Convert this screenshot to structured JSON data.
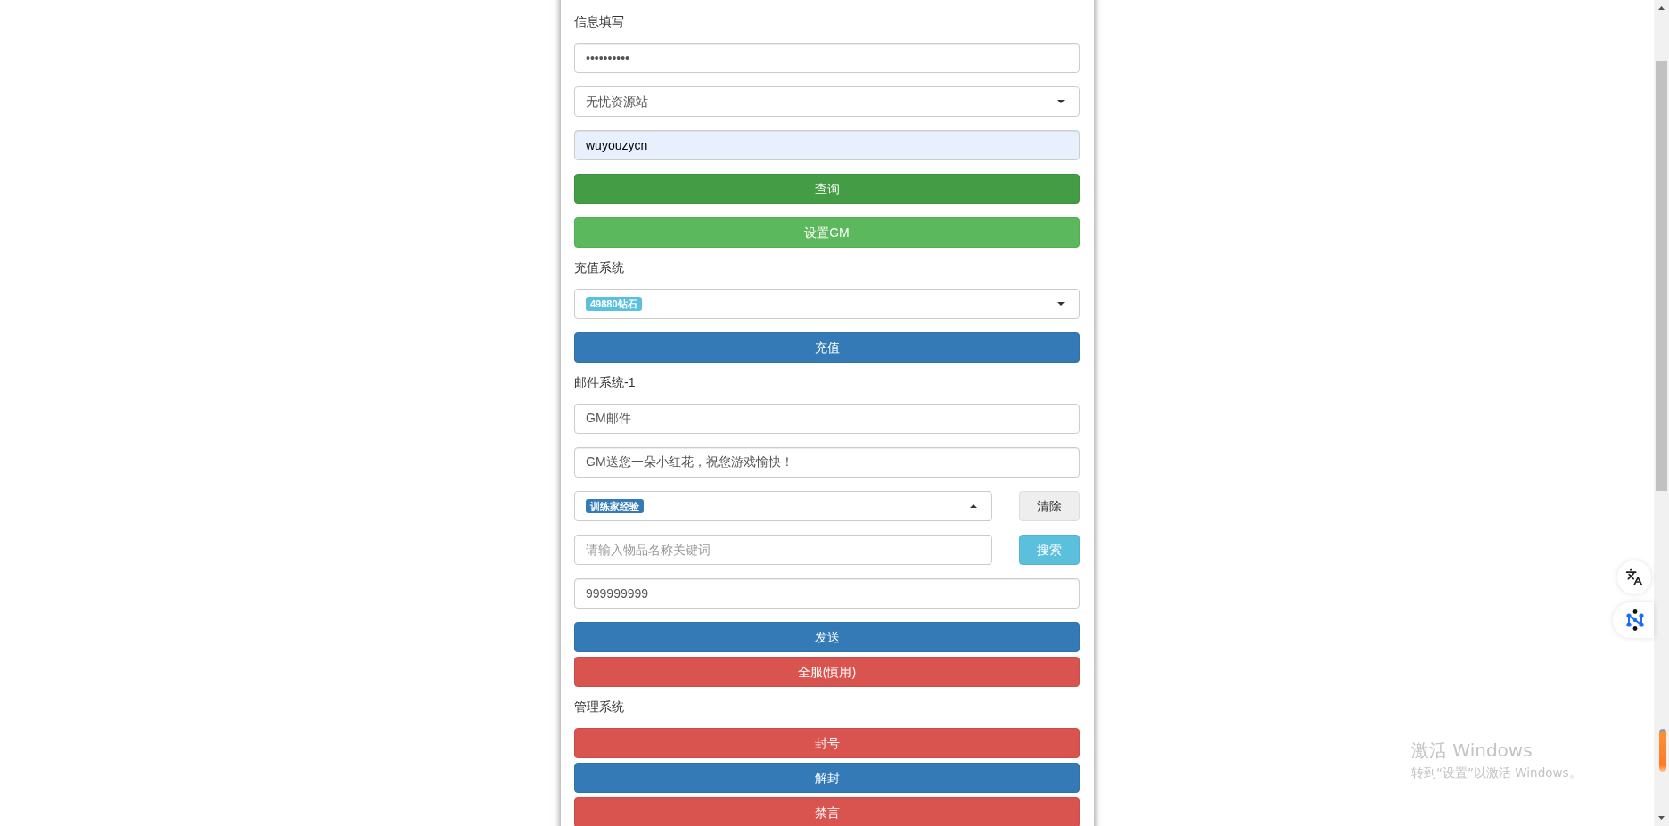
{
  "sections": [
    {
      "heading": "信息填写",
      "items": [
        {
          "kind": "password",
          "value": "••••••••••",
          "autofilled": false
        },
        {
          "kind": "select",
          "value": "无忧资源站",
          "expanded": false
        },
        {
          "kind": "input",
          "value": "wuyouzycn",
          "autofilled": true
        },
        {
          "kind": "button",
          "label": "查询",
          "color": "#449d44"
        },
        {
          "kind": "button",
          "label": "设置GM",
          "color": "#5cb85c"
        }
      ]
    },
    {
      "heading": "充值系统",
      "items": [
        {
          "kind": "tag_select",
          "tag": {
            "label": "49880钻石",
            "color": "#5bc0de"
          },
          "expanded": false
        },
        {
          "kind": "button",
          "label": "充值",
          "color": "#337ab7"
        }
      ]
    },
    {
      "heading": "邮件系统-1",
      "items": [
        {
          "kind": "input",
          "value": "GM邮件",
          "autofilled": false
        },
        {
          "kind": "input",
          "value": "GM送您一朵小红花，祝您游戏愉快！",
          "autofilled": false
        },
        {
          "kind": "tag_select",
          "tag": {
            "label": "训练家经验",
            "color": "#337ab7"
          },
          "expanded": true,
          "button": {
            "label": "清除",
            "color": "#eeeeee"
          }
        },
        {
          "kind": "input",
          "placeholder": "请输入物品名称关键词",
          "autofilled": false,
          "button": {
            "label": "搜索",
            "color": "#5bc0de"
          }
        },
        {
          "kind": "input",
          "value": "999999999",
          "autofilled": false
        },
        {
          "kind": "button_group",
          "buttons": [
            {
              "label": "发送",
              "color": "#337ab7"
            },
            {
              "label": "全服(慎用)",
              "color": "#d9534f"
            }
          ]
        }
      ]
    },
    {
      "heading": "管理系统",
      "items": [
        {
          "kind": "button_group",
          "buttons": [
            {
              "label": "封号",
              "color": "#d9534f"
            },
            {
              "label": "解封",
              "color": "#337ab7"
            },
            {
              "label": "禁言",
              "color": "#d9534f"
            }
          ]
        }
      ]
    }
  ],
  "activation_notice": {
    "title": "激活 Windows",
    "message": "转到“设置”以激活 Windows。"
  }
}
